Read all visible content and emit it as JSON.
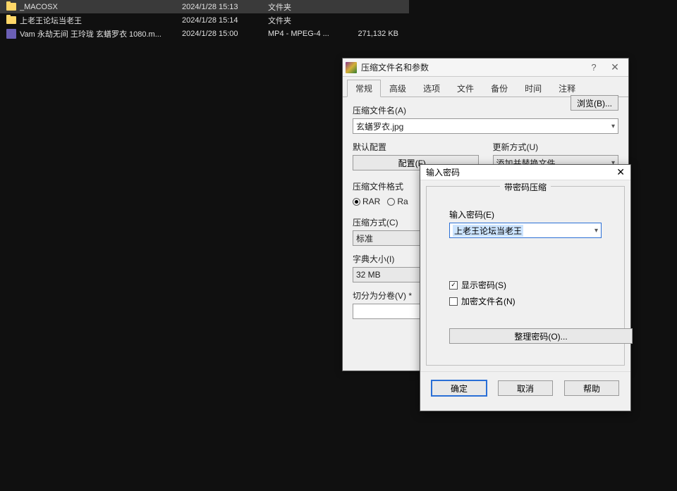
{
  "files": [
    {
      "name": "_MACOSX",
      "date": "2024/1/28 15:13",
      "type": "文件夹",
      "size": "",
      "icon": "folder"
    },
    {
      "name": "上老王论坛当老王",
      "date": "2024/1/28 15:14",
      "type": "文件夹",
      "size": "",
      "icon": "folder"
    },
    {
      "name": "Vam 永劫无间 王玲珑 玄蟮罗衣 1080.m...",
      "date": "2024/1/28 15:00",
      "type": "MP4 - MPEG-4 ...",
      "size": "271,132 KB",
      "icon": "video"
    }
  ],
  "archiveDialog": {
    "title": "压缩文件名和参数",
    "tabs": [
      "常规",
      "高级",
      "选项",
      "文件",
      "备份",
      "时间",
      "注释"
    ],
    "archiveNameLabel": "压缩文件名(A)",
    "archiveName": "玄蟮罗衣.jpg",
    "browseBtn": "浏览(B)...",
    "defaultConfigLabel": "默认配置",
    "configBtn": "配置(F)...",
    "updateModeLabel": "更新方式(U)",
    "updateMode": "添加并替换文件",
    "formatLabel": "压缩文件格式",
    "formatRar": "RAR",
    "formatRar4": "Ra",
    "methodLabel": "压缩方式(C)",
    "method": "标准",
    "dictLabel": "字典大小(I)",
    "dict": "32 MB",
    "splitLabel": "切分为分卷(V) *",
    "splitValue": ""
  },
  "pwdDialog": {
    "title": "输入密码",
    "groupTitle": "带密码压缩",
    "enterPwdLabel": "输入密码(E)",
    "pwdValue": "上老王论坛当老王",
    "showPwd": "显示密码(S)",
    "encryptNames": "加密文件名(N)",
    "manageBtn": "整理密码(O)...",
    "okBtn": "确定",
    "cancelBtn": "取消",
    "helpBtn": "帮助"
  }
}
